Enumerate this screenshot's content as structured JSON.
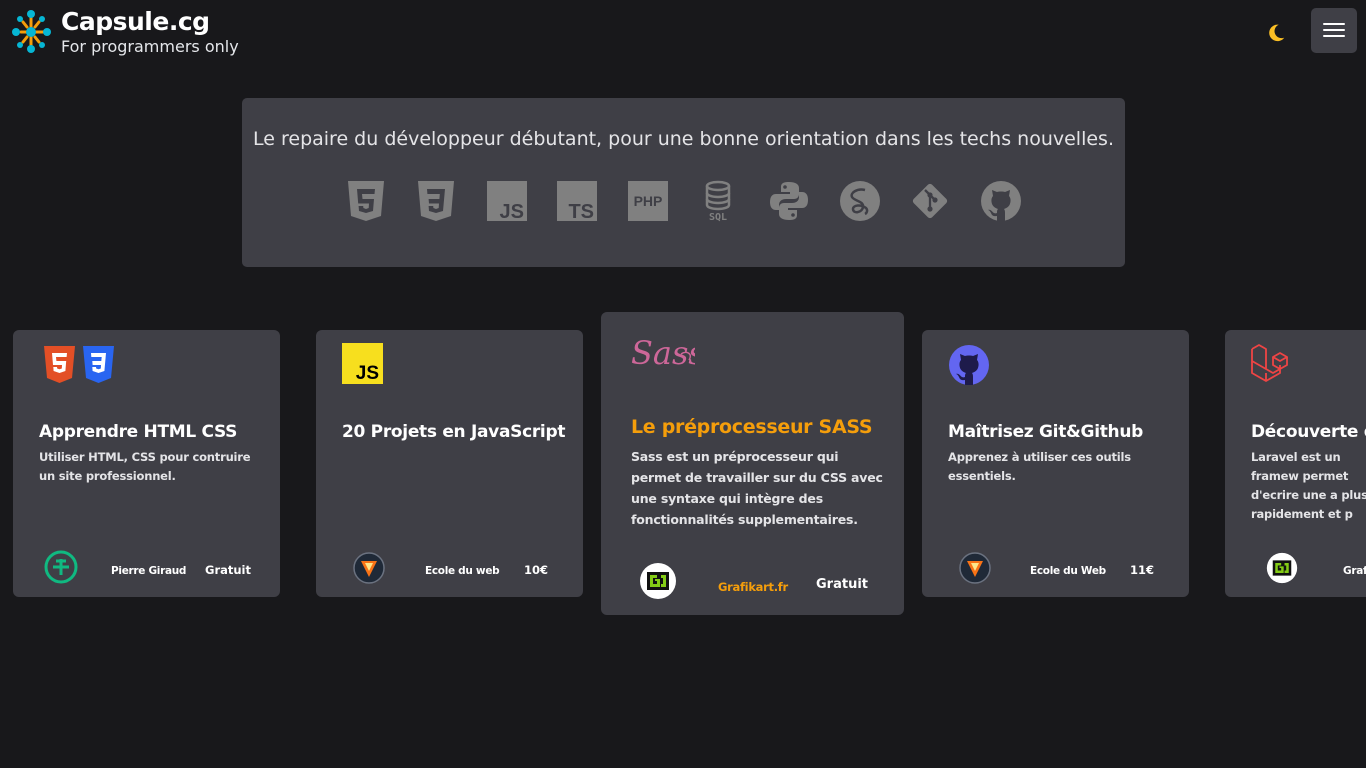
{
  "header": {
    "brand_name": "Capsule.cg",
    "tagline": "For programmers only",
    "theme_icon": "moon-icon",
    "menu_icon": "hamburger-menu-icon"
  },
  "hero": {
    "text": "Le repaire du développeur débutant, pour une bonne orientation dans les techs nouvelles.",
    "tech_icons": [
      "html5-icon",
      "css3-icon",
      "javascript-icon",
      "typescript-icon",
      "php-icon",
      "sql-icon",
      "python-icon",
      "sass-icon",
      "git-icon",
      "github-icon"
    ],
    "icon_labels": {
      "js": "JS",
      "ts": "TS",
      "php": "PHP",
      "sql": "SQL"
    }
  },
  "courses": [
    {
      "title": "Apprendre HTML CSS",
      "description": "Utiliser HTML, CSS pour contruire un site professionnel.",
      "author": "Pierre Giraud",
      "price": "Gratuit",
      "icon": "html5-css3-icon"
    },
    {
      "title": "20 Projets en JavaScript",
      "description": "",
      "author": "Ecole du web",
      "price": "10€",
      "icon": "javascript-icon"
    },
    {
      "title": "Le préprocesseur SASS",
      "description": "Sass est un préprocesseur qui permet de travailler sur du CSS avec une syntaxe qui intègre des fonctionnalités supplementaires.",
      "author": "Grafikart.fr",
      "price": "Gratuit",
      "icon": "sass-logo-icon"
    },
    {
      "title": "Maîtrisez Git&Github",
      "description": "Apprenez à utiliser ces outils essentiels.",
      "author": "Ecole du Web",
      "price": "11€",
      "icon": "github-icon"
    },
    {
      "title": "Découverte de",
      "description": "Laravel est un framew permet d'ecrire une a plus rapidement et p",
      "author": "Grafi",
      "price": "",
      "icon": "laravel-icon"
    }
  ],
  "logo_text": {
    "js": "JS",
    "sass": "Sass"
  },
  "colors": {
    "background": "#18181b",
    "panel": "#3f3f46",
    "accent": "#f59e0b",
    "html5": "#e34f26",
    "css3": "#1572b6",
    "javascript": "#f7df1e",
    "sass": "#cd6799",
    "github": "#6366f1",
    "laravel": "#ef4444"
  }
}
